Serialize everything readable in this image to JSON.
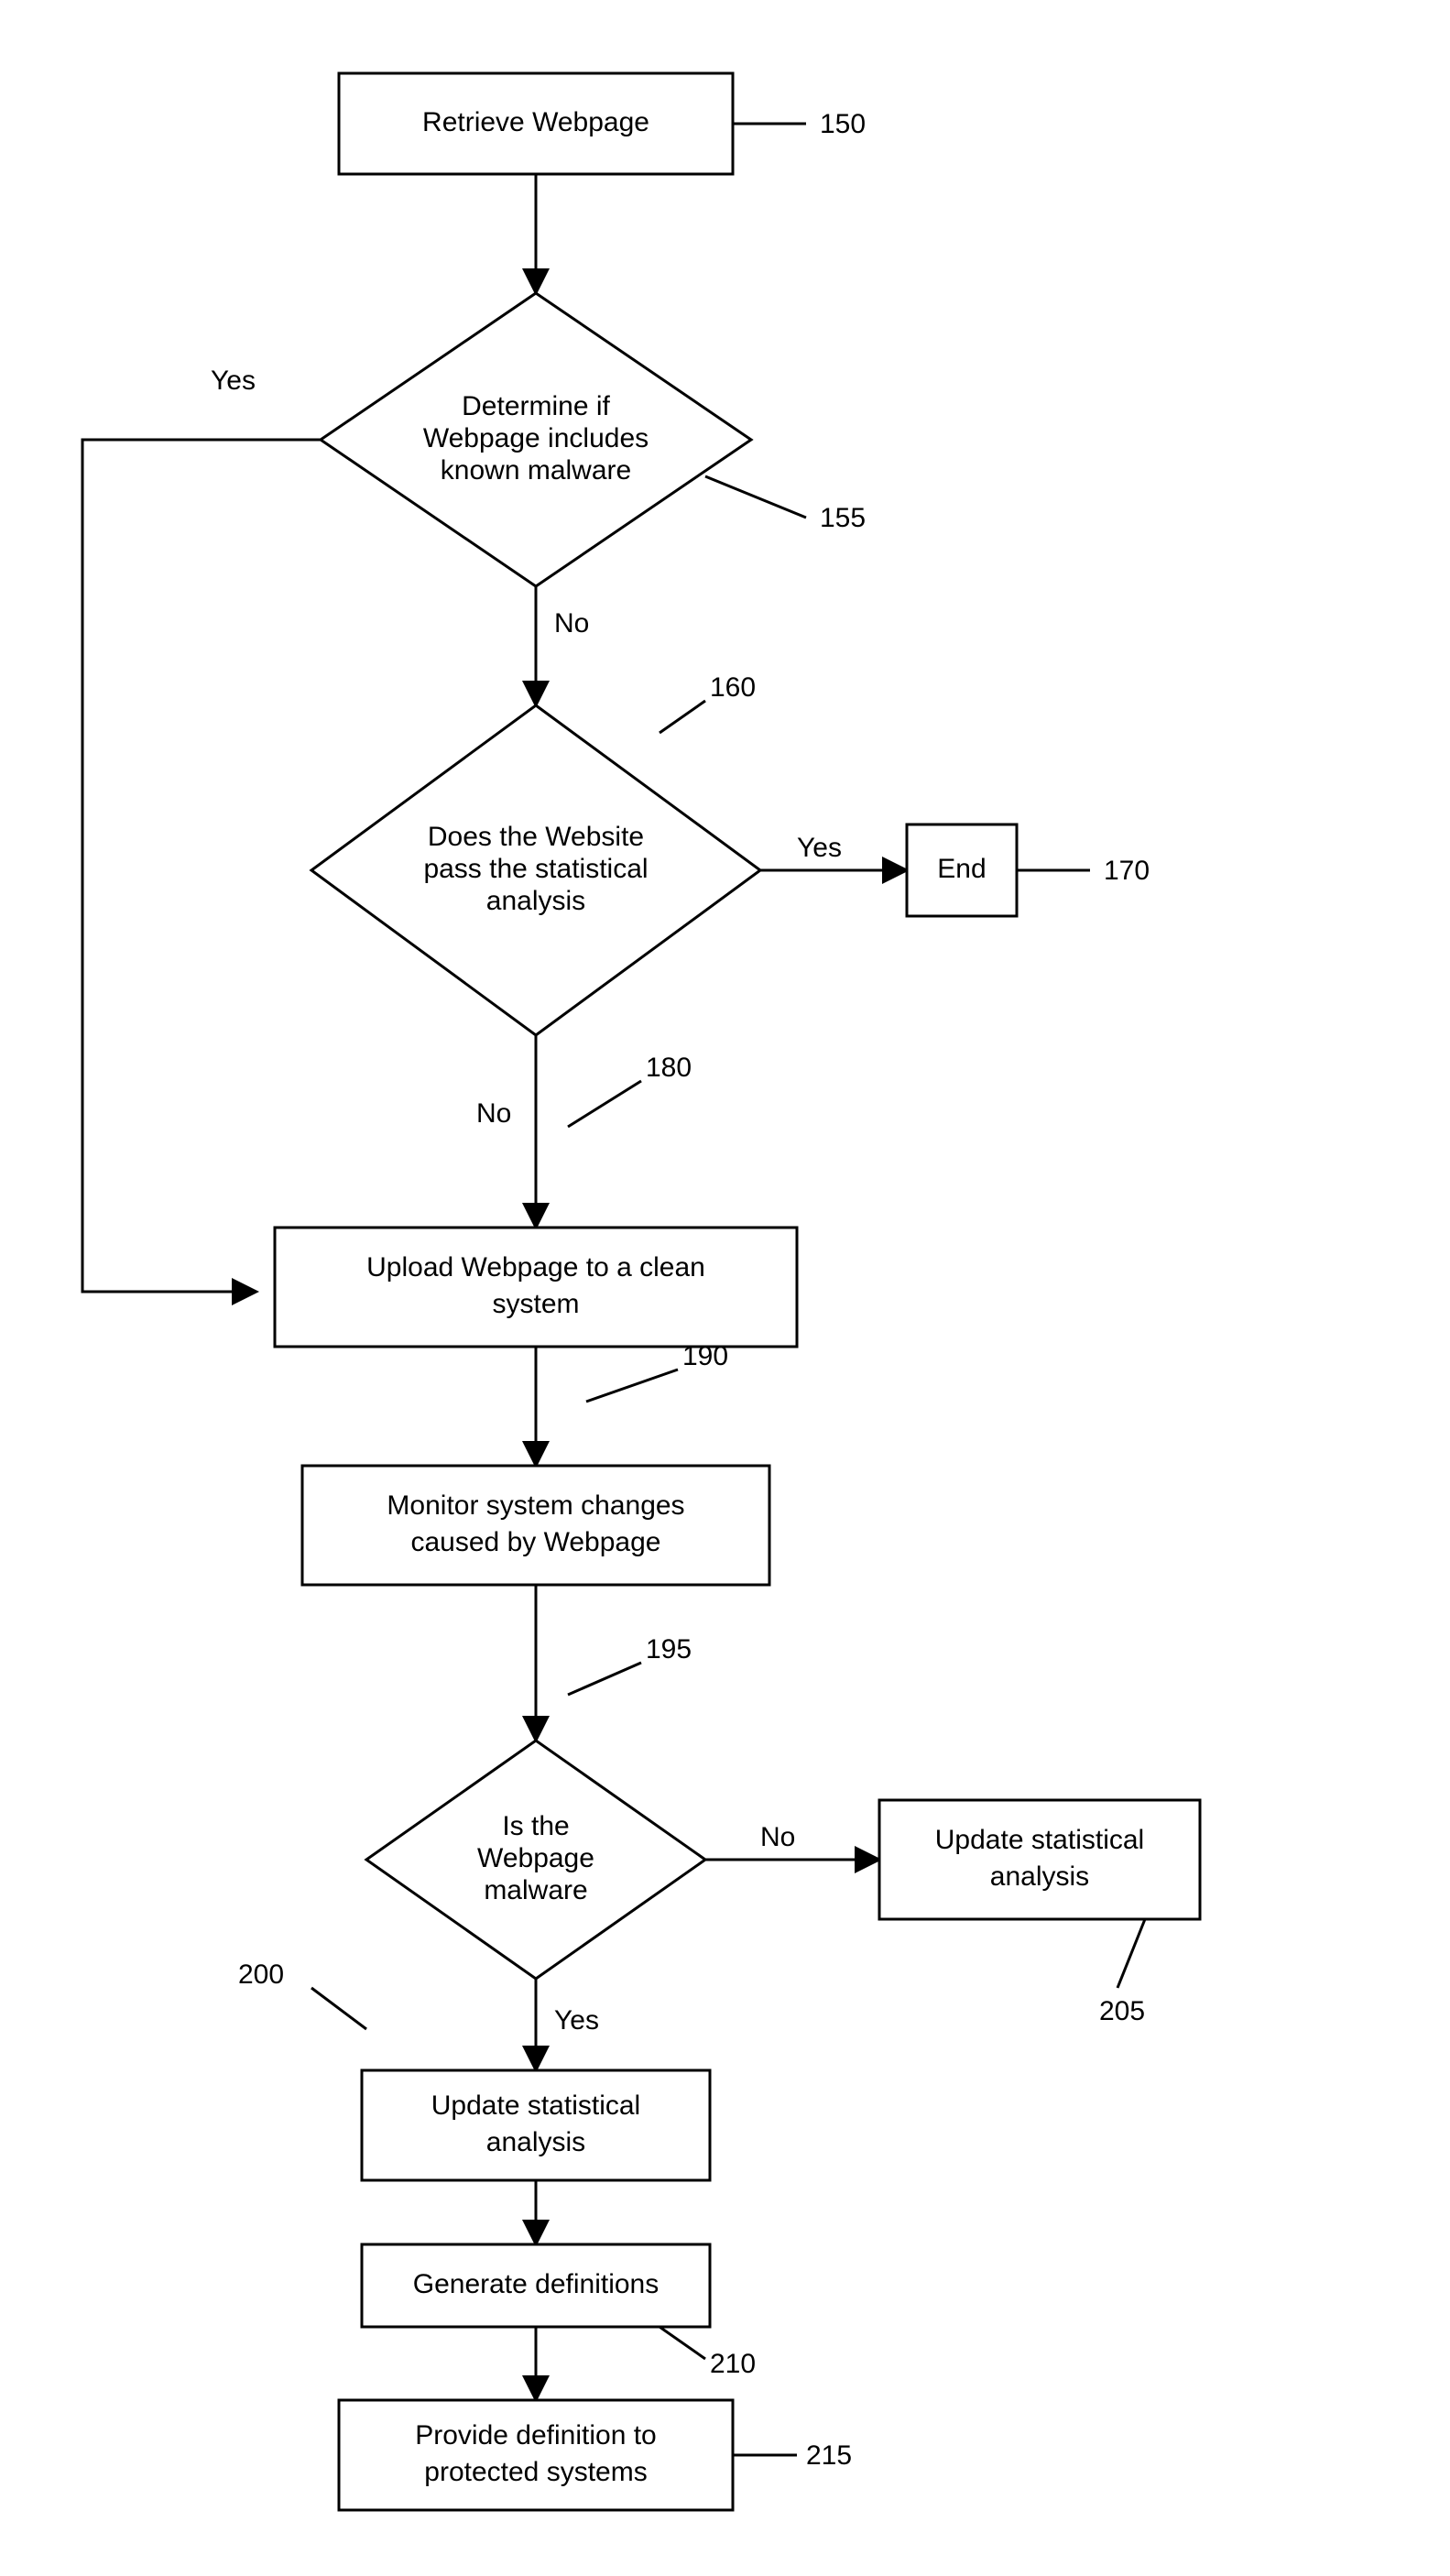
{
  "nodes": {
    "n150": {
      "text": "Retrieve Webpage",
      "ref": "150"
    },
    "n155": {
      "l1": "Determine if",
      "l2": "Webpage includes",
      "l3": "known malware",
      "ref": "155"
    },
    "n160": {
      "l1": "Does the Website",
      "l2": "pass the statistical",
      "l3": "analysis",
      "ref": "160"
    },
    "n170": {
      "text": "End",
      "ref": "170"
    },
    "n180": {
      "l1": "Upload Webpage to a clean",
      "l2": "system",
      "ref": "180"
    },
    "n190": {
      "l1": "Monitor system changes",
      "l2": "caused by Webpage",
      "ref": "190"
    },
    "n195": {
      "l1": "Is the",
      "l2": "Webpage",
      "l3": "malware",
      "ref": "195"
    },
    "n200": {
      "l1": "Update statistical",
      "l2": "analysis",
      "ref": "200"
    },
    "n205": {
      "l1": "Update statistical",
      "l2": "analysis",
      "ref": "205"
    },
    "n210": {
      "text": "Generate definitions",
      "ref": "210"
    },
    "n215": {
      "l1": "Provide definition to",
      "l2": "protected systems",
      "ref": "215"
    }
  },
  "edges": {
    "yes155": "Yes",
    "no155": "No",
    "yes160": "Yes",
    "no160": "No",
    "yes195": "Yes",
    "no195": "No"
  }
}
